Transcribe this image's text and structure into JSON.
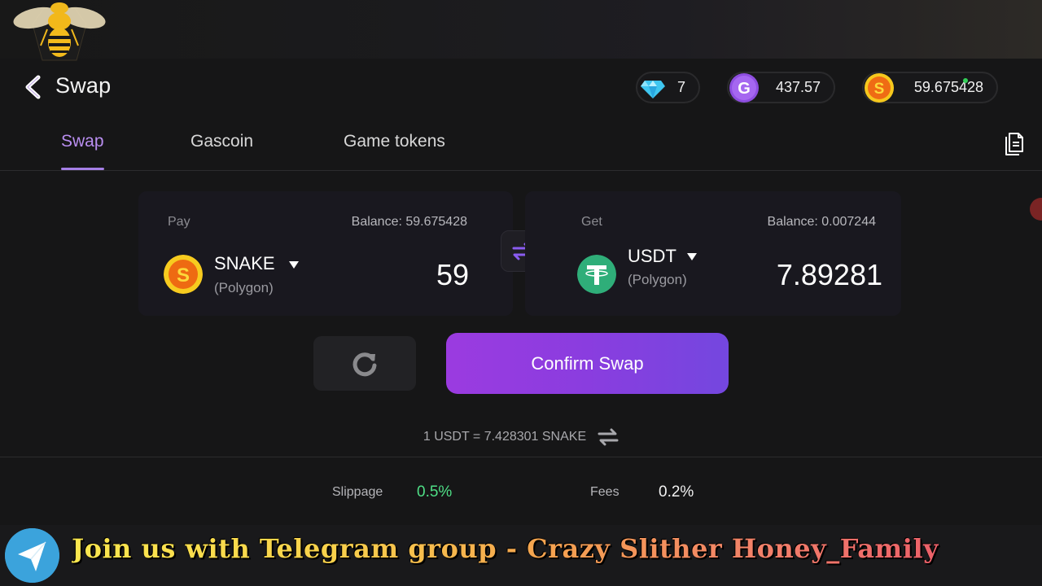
{
  "header": {
    "title": "Swap",
    "balances": [
      {
        "icon": "gem-icon",
        "value": "7"
      },
      {
        "icon": "gascoin-icon",
        "value": "437.57",
        "icon_letter": "G"
      },
      {
        "icon": "snake-coin-icon",
        "value": "59.675428",
        "icon_letter": "S"
      }
    ]
  },
  "tabs": [
    {
      "label": "Swap",
      "active": true
    },
    {
      "label": "Gascoin",
      "active": false
    },
    {
      "label": "Game tokens",
      "active": false
    }
  ],
  "pay": {
    "label": "Pay",
    "balance": "Balance: 59.675428",
    "token": "SNAKE",
    "network": "(Polygon)",
    "amount": "59",
    "icon_letter": "S"
  },
  "get": {
    "label": "Get",
    "balance": "Balance: 0.007244",
    "token": "USDT",
    "network": "(Polygon)",
    "amount": "7.89281",
    "icon_letter": "T"
  },
  "actions": {
    "confirm_label": "Confirm Swap"
  },
  "rate": "1 USDT = 7.428301 SNAKE",
  "details": {
    "slippage_label": "Slippage",
    "slippage_value": "0.5%",
    "fees_label": "Fees",
    "fees_value": "0.2%"
  },
  "banner": {
    "text": "Join us with Telegram group - Crazy Slither Honey_Family"
  },
  "colors": {
    "accent": "#a57fe6",
    "confirm_gradient_start": "#9b3be0",
    "confirm_gradient_end": "#7447df",
    "slippage_green": "#4fdf86",
    "usdt_green": "#2fae79",
    "telegram_blue": "#3ba3dc"
  }
}
